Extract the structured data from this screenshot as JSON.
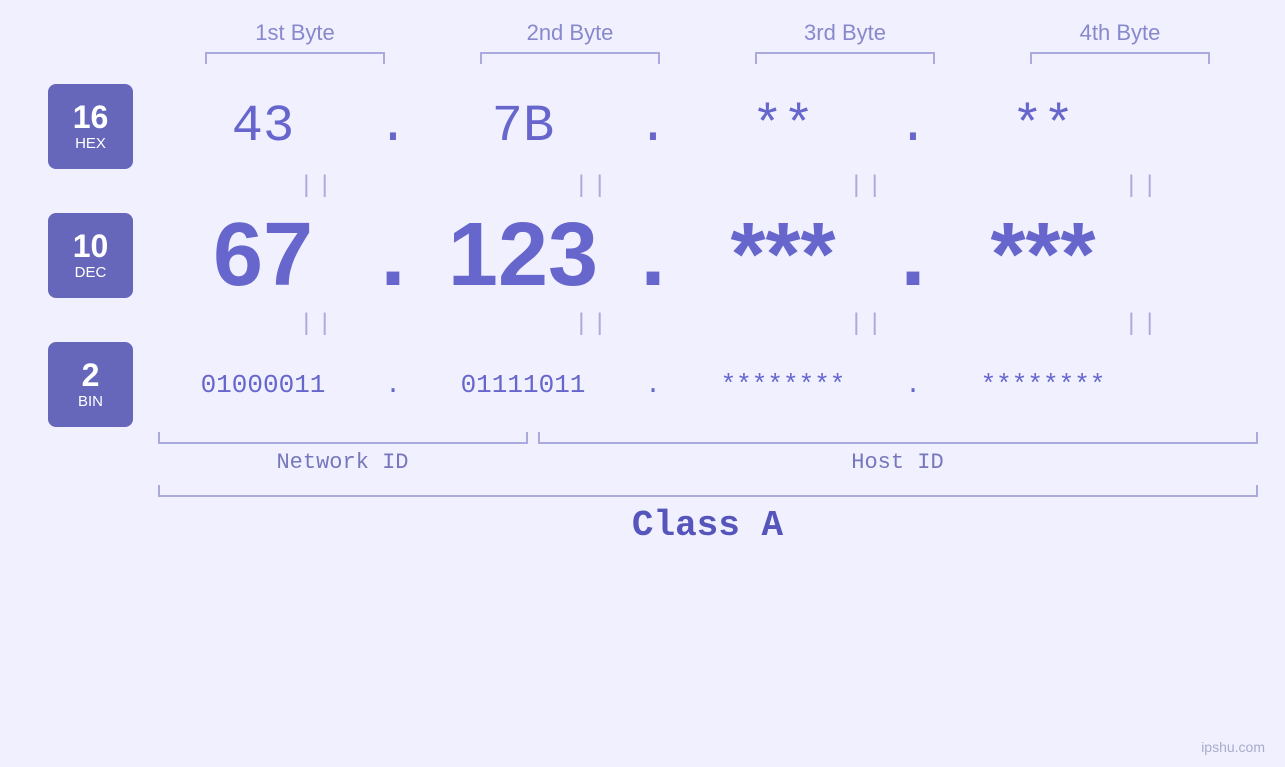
{
  "headers": {
    "byte1": "1st Byte",
    "byte2": "2nd Byte",
    "byte3": "3rd Byte",
    "byte4": "4th Byte"
  },
  "hex_row": {
    "badge_number": "16",
    "badge_name": "HEX",
    "byte1": "43",
    "byte2": "7B",
    "byte3": "**",
    "byte4": "**",
    "dot": "."
  },
  "dec_row": {
    "badge_number": "10",
    "badge_name": "DEC",
    "byte1": "67",
    "byte2": "123",
    "byte3": "***",
    "byte4": "***",
    "dot": "."
  },
  "bin_row": {
    "badge_number": "2",
    "badge_name": "BIN",
    "byte1": "01000011",
    "byte2": "01111011",
    "byte3": "********",
    "byte4": "********",
    "dot": "."
  },
  "labels": {
    "network_id": "Network ID",
    "host_id": "Host ID",
    "class": "Class A"
  },
  "watermark": "ipshu.com",
  "equals_sign": "||"
}
